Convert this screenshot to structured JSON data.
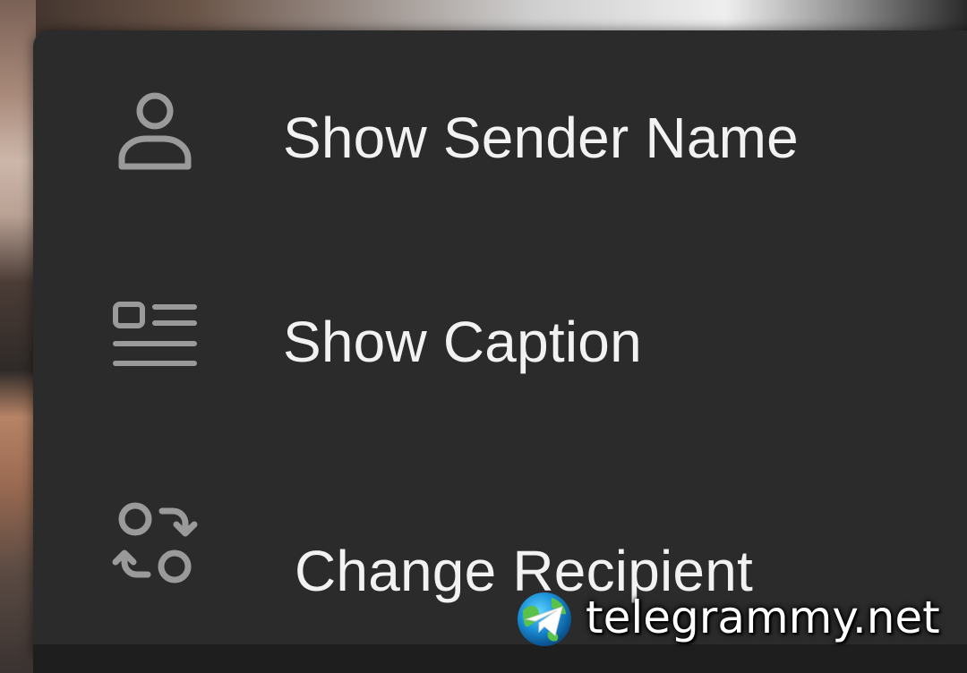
{
  "menu": {
    "items": [
      {
        "label": "Show Sender Name",
        "icon": "person-icon"
      },
      {
        "label": "Show Caption",
        "icon": "caption-icon"
      },
      {
        "label": "Change Recipient",
        "icon": "swap-recipient-icon"
      }
    ]
  },
  "watermark": {
    "text": "telegrammy.net",
    "icon": "telegram-globe-logo"
  },
  "colors": {
    "menu_background": "#2b2b2b",
    "label_text": "#f2f2f2",
    "icon_stroke": "#9a9a9a"
  }
}
